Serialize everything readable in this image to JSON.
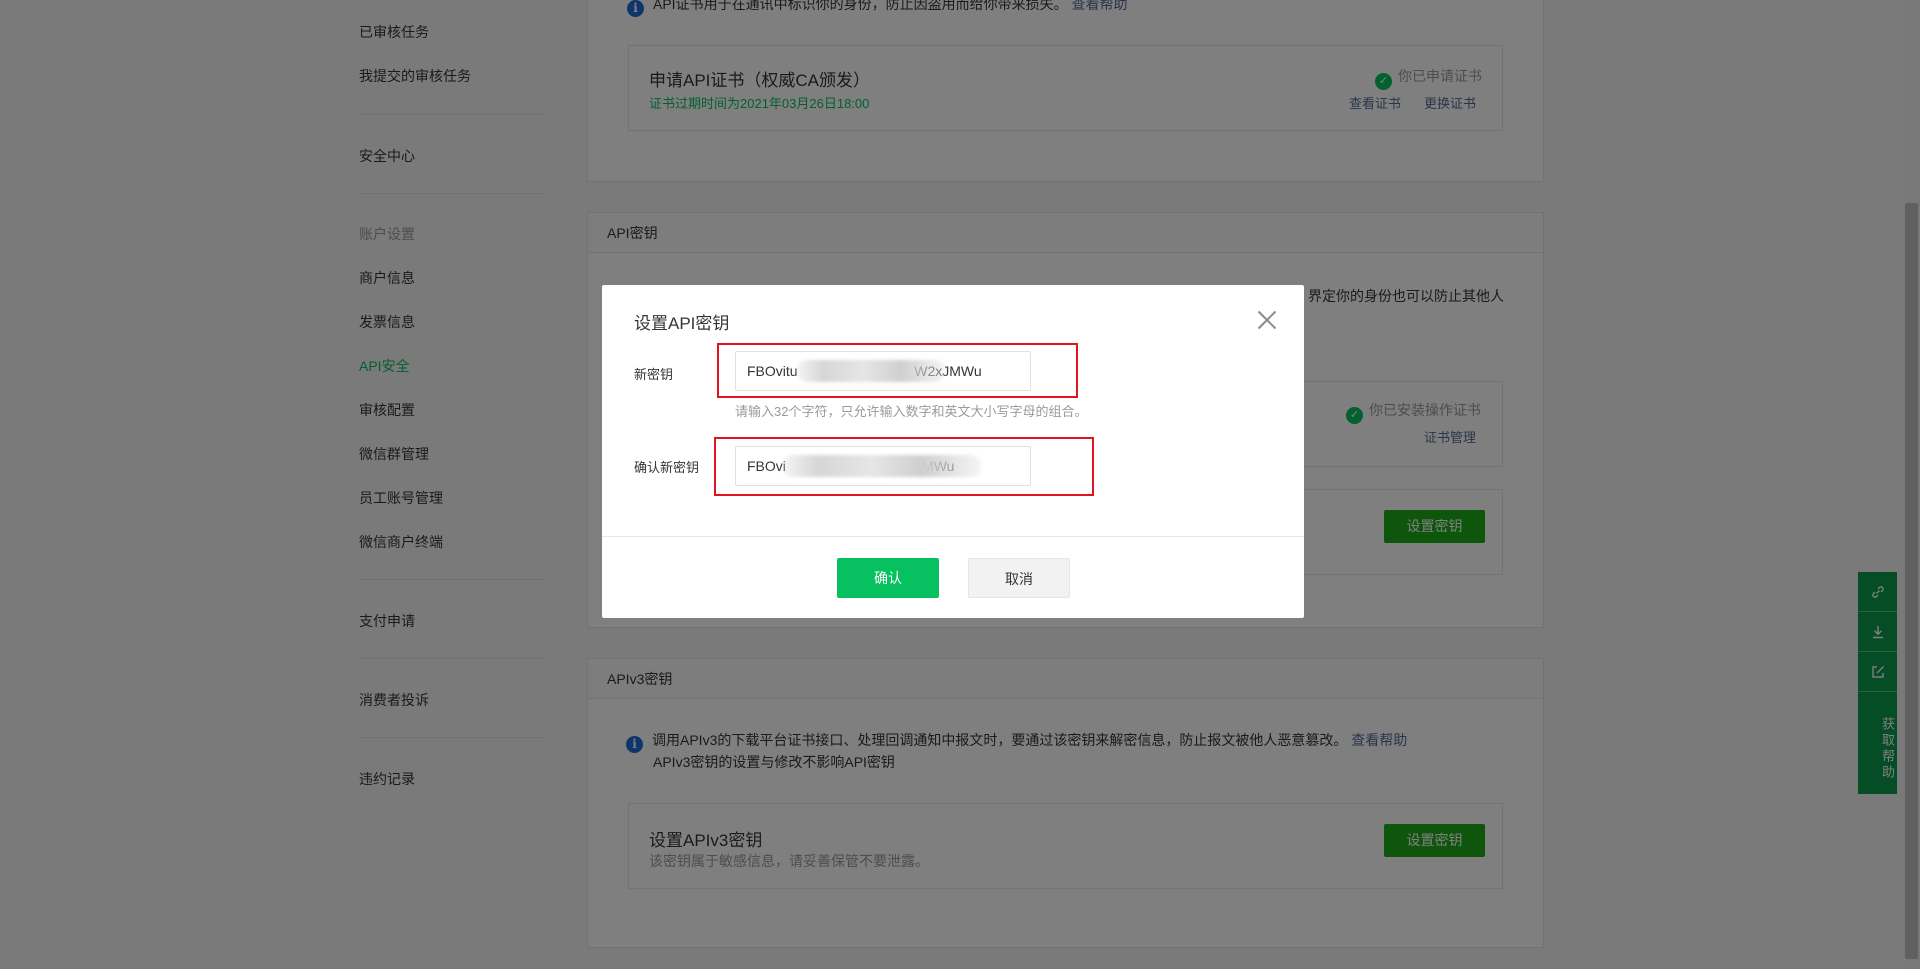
{
  "sidebar": {
    "items": [
      {
        "label": "已审核任务",
        "state": "normal"
      },
      {
        "label": "我提交的审核任务",
        "state": "normal"
      },
      {
        "label": "安全中心",
        "state": "normal"
      },
      {
        "label": "账户设置",
        "state": "muted"
      },
      {
        "label": "商户信息",
        "state": "normal"
      },
      {
        "label": "发票信息",
        "state": "normal"
      },
      {
        "label": "API安全",
        "state": "active"
      },
      {
        "label": "审核配置",
        "state": "normal"
      },
      {
        "label": "微信群管理",
        "state": "normal"
      },
      {
        "label": "员工账号管理",
        "state": "normal"
      },
      {
        "label": "微信商户终端",
        "state": "normal"
      },
      {
        "label": "支付申请",
        "state": "normal"
      },
      {
        "label": "消费者投诉",
        "state": "normal"
      },
      {
        "label": "违约记录",
        "state": "normal"
      }
    ]
  },
  "cert_section": {
    "info_text": "API证书用于在通讯中标识你的身份，防止因盗用而给你带来损失。",
    "info_link": "查看帮助",
    "card": {
      "title": "申请API证书（权威CA颁发）",
      "expiry": "证书过期时间为2021年03月26日18:00",
      "status": "你已申请证书",
      "link_view": "查看证书",
      "link_replace": "更换证书"
    }
  },
  "api_key_section": {
    "title": "API密钥",
    "partial_text": "界定你的身份也可以防止其他人",
    "card1": {
      "status": "你已安装操作证书",
      "link": "证书管理"
    },
    "card2": {
      "button": "设置密钥"
    }
  },
  "apiv3_section": {
    "title": "APIv3密钥",
    "info_text": "调用APIv3的下载平台证书接口、处理回调通知中报文时，要通过该密钥来解密信息，防止报文被他人恶意篡改。",
    "info_link": "查看帮助",
    "info_text2": "APIv3密钥的设置与修改不影响API密钥",
    "card": {
      "title": "设置APIv3密钥",
      "subtitle": "该密钥属于敏感信息，请妥善保管不要泄露。",
      "button": "设置密钥"
    }
  },
  "modal": {
    "title": "设置API密钥",
    "new_key_label": "新密钥",
    "new_key_value": "FBOvitu                              W2xJMWu",
    "hint": "请输入32个字符，只允许输入数字和英文大小写字母的组合。",
    "confirm_key_label": "确认新密钥",
    "confirm_key_value": "FBOvi                                   MWu",
    "confirm_button": "确认",
    "cancel_button": "取消"
  },
  "float_toolbar": {
    "icons": [
      "link-icon",
      "download-icon",
      "edit-icon"
    ],
    "help_label": "获取帮助",
    "color": "#0a9b4a"
  },
  "colors": {
    "accent_green": "#07c160",
    "link_blue": "#576b95",
    "highlight_red": "#e0141e"
  }
}
